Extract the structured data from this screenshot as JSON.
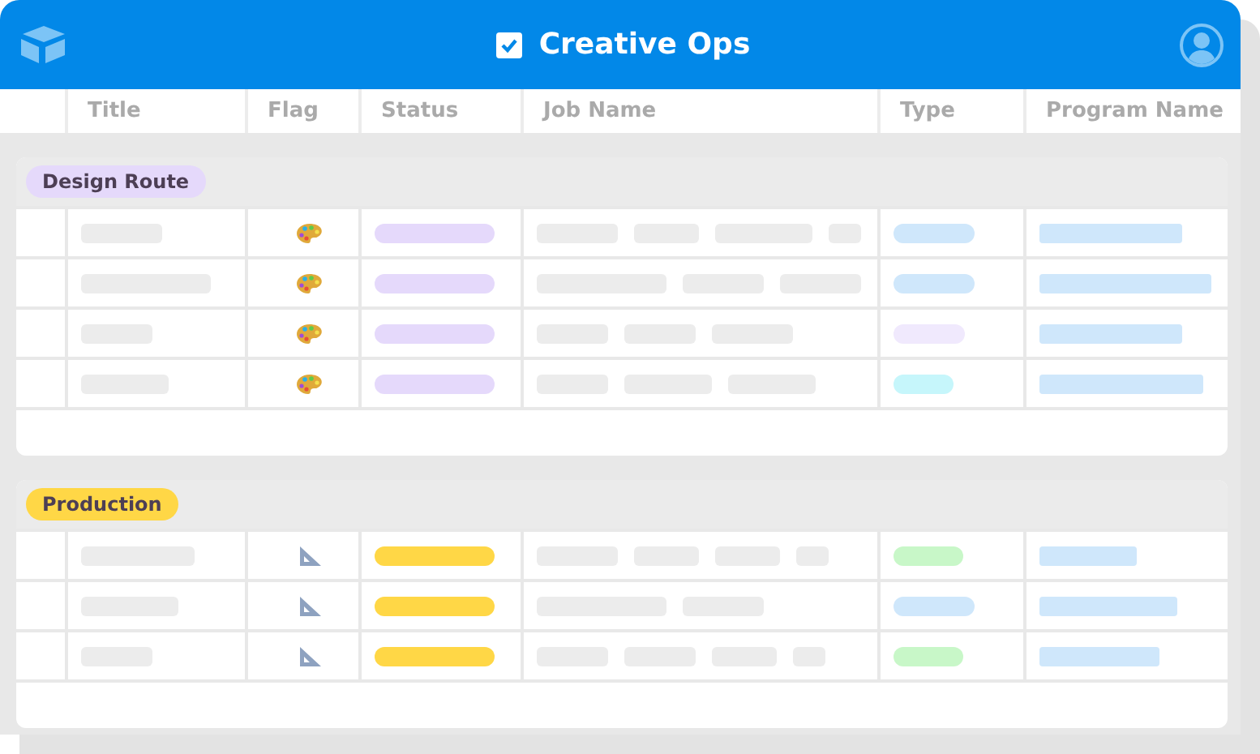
{
  "window": {
    "title": "Creative Ops",
    "checkbox": {
      "checked": true
    }
  },
  "columns": [
    "Title",
    "Flag",
    "Status",
    "Job Name",
    "Type",
    "Program Name"
  ],
  "groups": [
    {
      "label": "Design Route",
      "color": "#e5d9fb",
      "rows": [
        {
          "flag": {
            "kind": "palette"
          },
          "type": {
            "color": "#cfe7fb"
          }
        },
        {
          "flag": {
            "kind": "palette"
          },
          "type": {
            "color": "#cfe7fb"
          }
        },
        {
          "flag": {
            "kind": "palette"
          },
          "type": {
            "color": "#f0e9fd"
          }
        },
        {
          "flag": {
            "kind": "palette"
          },
          "type": {
            "color": "#c6f6fb"
          }
        }
      ]
    },
    {
      "label": "Production",
      "color": "#ffd746",
      "rows": [
        {
          "flag": {
            "kind": "ruler"
          },
          "type": {
            "color": "#c8f7c8"
          }
        },
        {
          "flag": {
            "kind": "ruler"
          },
          "type": {
            "color": "#cfe7fb"
          }
        },
        {
          "flag": {
            "kind": "ruler"
          },
          "type": {
            "color": "#c8f7c8"
          }
        }
      ]
    }
  ]
}
